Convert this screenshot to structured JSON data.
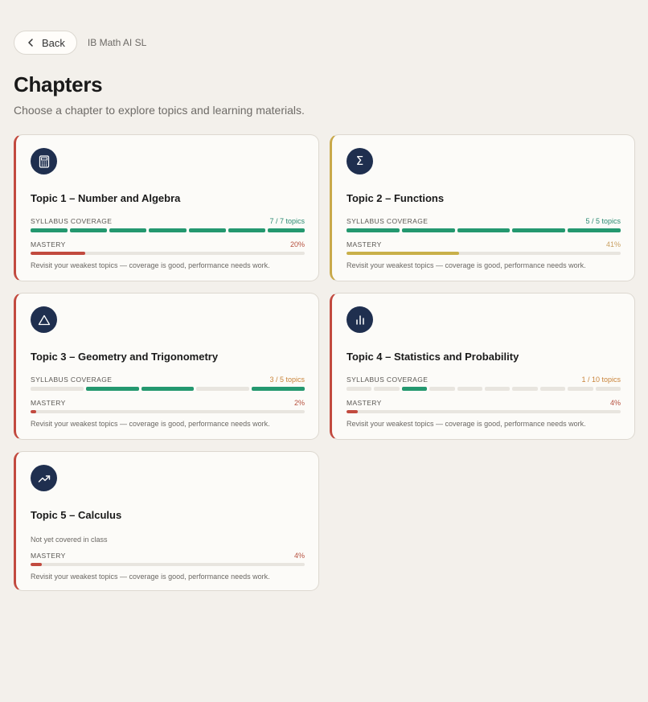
{
  "nav": {
    "back_label": "Back",
    "breadcrumb": "IB Math AI SL"
  },
  "header": {
    "title": "Chapters",
    "subtitle": "Choose a chapter to explore topics and learning materials."
  },
  "labels": {
    "coverage": "Syllabus coverage",
    "mastery": "Mastery"
  },
  "colors": {
    "accent_red": "#c24a3f",
    "accent_gold": "#c9a94a",
    "coverage_green": "#24986f",
    "icon_bg": "#1f2f4f"
  },
  "chapters": [
    {
      "title": "Topic 1 – Number and Algebra",
      "icon": "calculator-icon",
      "accent": "red",
      "coverage": {
        "text": "7 / 7 topics",
        "total": 7,
        "covered": [
          0,
          1,
          2,
          3,
          4,
          5,
          6
        ]
      },
      "mastery": {
        "text": "20%",
        "value": 0.2
      },
      "note": "Revisit your weakest topics — coverage is good, performance needs work."
    },
    {
      "title": "Topic 2 – Functions",
      "icon": "sigma-icon",
      "accent": "gold",
      "coverage": {
        "text": "5 / 5 topics",
        "total": 5,
        "covered": [
          0,
          1,
          2,
          3,
          4
        ]
      },
      "mastery": {
        "text": "41%",
        "value": 0.41
      },
      "note": "Revisit your weakest topics — coverage is good, performance needs work."
    },
    {
      "title": "Topic 3 – Geometry and Trigonometry",
      "icon": "triangle-icon",
      "accent": "red",
      "coverage": {
        "text": "3 / 5 topics",
        "total": 5,
        "covered": [
          1,
          2,
          4
        ]
      },
      "mastery": {
        "text": "2%",
        "value": 0.02
      },
      "note": "Revisit your weakest topics — coverage is good, performance needs work."
    },
    {
      "title": "Topic 4 – Statistics and Probability",
      "icon": "bar-chart-icon",
      "accent": "red",
      "coverage": {
        "text": "1 / 10 topics",
        "total": 10,
        "covered": [
          2
        ]
      },
      "mastery": {
        "text": "4%",
        "value": 0.04
      },
      "note": "Revisit your weakest topics — coverage is good, performance needs work."
    },
    {
      "title": "Topic 5 – Calculus",
      "icon": "trending-up-icon",
      "accent": "red",
      "coverage_note": "Not yet covered in class",
      "mastery": {
        "text": "4%",
        "value": 0.04
      },
      "note": "Revisit your weakest topics — coverage is good, performance needs work."
    }
  ]
}
